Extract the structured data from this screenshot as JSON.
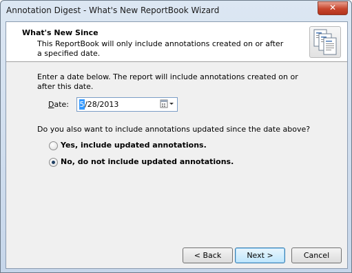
{
  "window": {
    "title": "Annotation Digest - What's New ReportBook Wizard",
    "close_glyph": "✕"
  },
  "header": {
    "title": "What's New Since",
    "description": "This ReportBook will only include annotations created on or after a specified date.",
    "icon": "reportbook-pages-icon"
  },
  "body": {
    "instruction": "Enter a date below.  The report will include annotations created on or after this date.",
    "date_label_underlined": "D",
    "date_label_rest": "ate:",
    "date_value_selected": "5",
    "date_value_rest": "/28/2013",
    "question": "Do you also want to include annotations updated since the date above?",
    "options": [
      {
        "label": "Yes, include updated annotations.",
        "checked": false
      },
      {
        "label": "No, do not include updated annotations.",
        "checked": true
      }
    ]
  },
  "buttons": {
    "back": "< Back",
    "next": "Next >",
    "cancel": "Cancel"
  }
}
